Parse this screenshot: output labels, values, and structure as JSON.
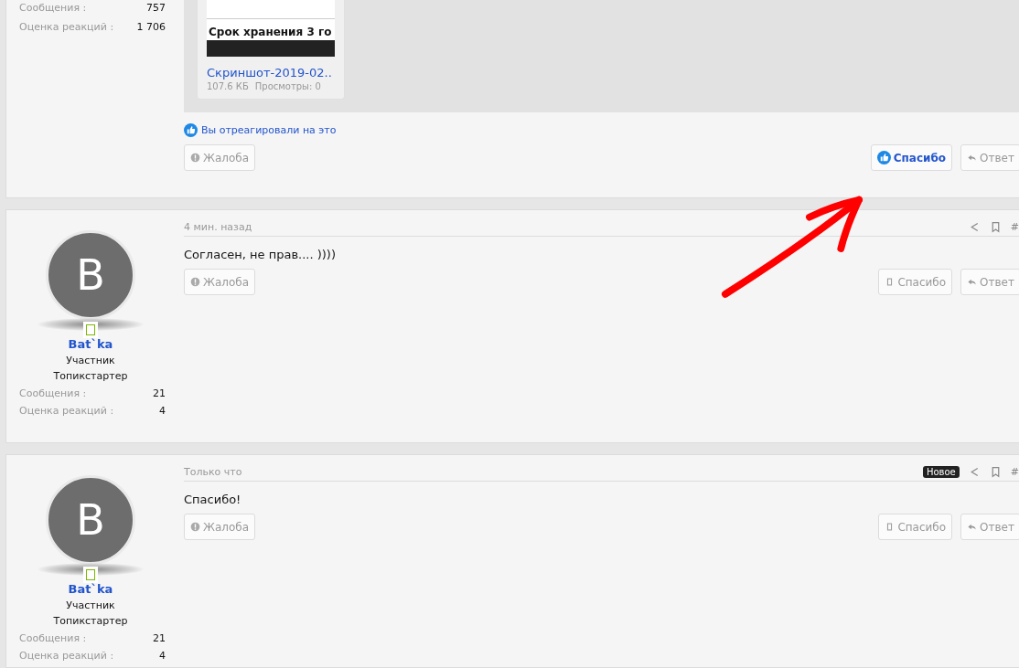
{
  "posts": [
    {
      "user": {
        "stats": [
          {
            "label": "Сообщения :",
            "value": "757"
          },
          {
            "label": "Оценка реакций :",
            "value": "1 706"
          }
        ]
      },
      "attachment": {
        "headline": "Срок хранения 3 го",
        "filename": "Скриншот-2019-02..",
        "size": "107.6 КБ",
        "views": "Просмотры: 0"
      },
      "reaction_note": "Вы отреагировали на это",
      "report": "Жалоба",
      "like": {
        "label": "Спасибо",
        "selected": true
      },
      "reply": "Ответ"
    },
    {
      "user": {
        "avatar_letter": "B",
        "online": true,
        "name": "Bat`ka",
        "titles": [
          "Участник",
          "Топикстартер"
        ],
        "stats": [
          {
            "label": "Сообщения :",
            "value": "21"
          },
          {
            "label": "Оценка реакций :",
            "value": "4"
          }
        ]
      },
      "time": "4 мин. назад",
      "is_new": false,
      "post_number": "#",
      "text": "Согласен, не прав.... ))))",
      "report": "Жалоба",
      "like": {
        "label": "Спасибо",
        "selected": false
      },
      "reply": "Ответ"
    },
    {
      "user": {
        "avatar_letter": "B",
        "online": true,
        "name": "Bat`ka",
        "titles": [
          "Участник",
          "Топикстартер"
        ],
        "stats": [
          {
            "label": "Сообщения :",
            "value": "21"
          },
          {
            "label": "Оценка реакций :",
            "value": "4"
          }
        ]
      },
      "time": "Только что",
      "is_new": true,
      "new_label": "Новое",
      "post_number": "#",
      "text": "Спасибо!",
      "report": "Жалоба",
      "like": {
        "label": "Спасибо",
        "selected": false
      },
      "reply": "Ответ"
    }
  ]
}
